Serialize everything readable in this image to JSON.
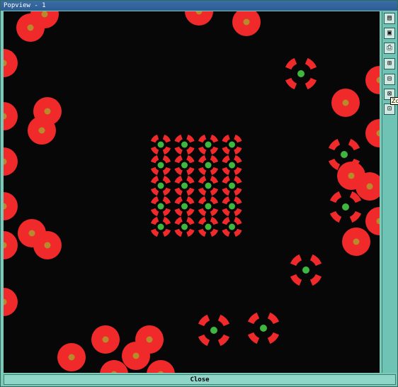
{
  "window": {
    "title": "Popview - 1"
  },
  "toolbar": {
    "tools": [
      {
        "name": "tool-properties-icon",
        "glyph": "▤"
      },
      {
        "name": "tool-window-icon",
        "glyph": "▣"
      },
      {
        "name": "tool-print-icon",
        "glyph": "⎙"
      },
      {
        "name": "tool-zoom-in-icon",
        "glyph": "⊞"
      },
      {
        "name": "tool-zoom-out-icon",
        "glyph": "⊟"
      },
      {
        "name": "tool-fit-icon",
        "glyph": "⊠"
      },
      {
        "name": "tool-zoom-box-icon",
        "glyph": "⊡"
      }
    ],
    "tooltip": "Zo"
  },
  "footer": {
    "close_label": "Close"
  },
  "colors": {
    "pad_red": "#f0292b",
    "pad_center": "#b88a2c",
    "via_green": "#3fb63f",
    "background": "#070707"
  }
}
